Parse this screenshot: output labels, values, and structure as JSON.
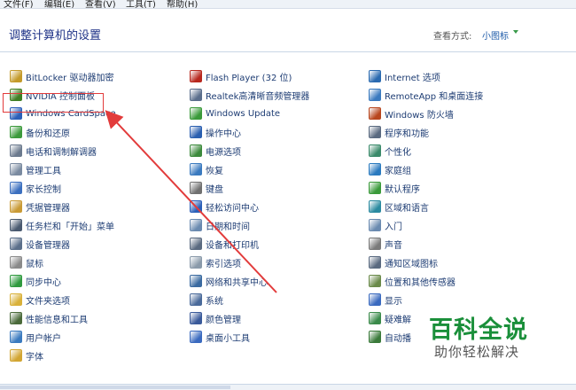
{
  "menubar": {
    "items": [
      "文件(F)",
      "编辑(E)",
      "查看(V)",
      "工具(T)",
      "帮助(H)"
    ]
  },
  "header": {
    "title": "调整计算机的设置",
    "view_by_label": "查看方式:",
    "view_mode": "小图标"
  },
  "columns": [
    [
      {
        "label": "BitLocker 驱动器加密",
        "icon": "bitlocker-icon",
        "color": "#c49a2a"
      },
      {
        "label": "NVIDIA 控制面板",
        "icon": "nvidia-icon",
        "color": "#3f7f24"
      },
      {
        "label": "Windows CardSpace",
        "icon": "cardspace-icon",
        "color": "#2b5fb8"
      },
      {
        "label": "备份和还原",
        "icon": "backup-icon",
        "color": "#3c9a3c"
      },
      {
        "label": "电话和调制解调器",
        "icon": "phone-modem-icon",
        "color": "#6b7a8e"
      },
      {
        "label": "管理工具",
        "icon": "admin-tools-icon",
        "color": "#7a8aa0"
      },
      {
        "label": "家长控制",
        "icon": "parental-control-icon",
        "color": "#3b6fbf"
      },
      {
        "label": "凭据管理器",
        "icon": "credential-icon",
        "color": "#c99a35"
      },
      {
        "label": "任务栏和「开始」菜单",
        "icon": "taskbar-icon",
        "color": "#4a5a70"
      },
      {
        "label": "设备管理器",
        "icon": "device-manager-icon",
        "color": "#5b6f8a"
      },
      {
        "label": "鼠标",
        "icon": "mouse-icon",
        "color": "#8a8a8a"
      },
      {
        "label": "同步中心",
        "icon": "sync-icon",
        "color": "#2f9a3f"
      },
      {
        "label": "文件夹选项",
        "icon": "folder-options-icon",
        "color": "#d9b13a"
      },
      {
        "label": "性能信息和工具",
        "icon": "performance-icon",
        "color": "#4a6a3a"
      },
      {
        "label": "用户帐户",
        "icon": "user-accounts-icon",
        "color": "#3a7abf"
      },
      {
        "label": "字体",
        "icon": "fonts-icon",
        "color": "#d2a532"
      }
    ],
    [
      {
        "label": "Flash Player (32 位)",
        "icon": "flash-icon",
        "color": "#b8281e"
      },
      {
        "label": "Realtek高清晰音频管理器",
        "icon": "realtek-icon",
        "color": "#5a6e8c"
      },
      {
        "label": "Windows Update",
        "icon": "windows-update-icon",
        "color": "#3a9a3a"
      },
      {
        "label": "操作中心",
        "icon": "action-center-icon",
        "color": "#2a5fb0"
      },
      {
        "label": "电源选项",
        "icon": "power-icon",
        "color": "#3c8a3c"
      },
      {
        "label": "恢复",
        "icon": "recovery-icon",
        "color": "#3a7abf"
      },
      {
        "label": "键盘",
        "icon": "keyboard-icon",
        "color": "#707070"
      },
      {
        "label": "轻松访问中心",
        "icon": "ease-access-icon",
        "color": "#2a5fb8"
      },
      {
        "label": "日期和时间",
        "icon": "date-time-icon",
        "color": "#6a8ab0"
      },
      {
        "label": "设备和打印机",
        "icon": "printer-icon",
        "color": "#5a6a80"
      },
      {
        "label": "索引选项",
        "icon": "indexing-icon",
        "color": "#8a9aaa"
      },
      {
        "label": "网络和共享中心",
        "icon": "network-icon",
        "color": "#3a6aa0"
      },
      {
        "label": "系统",
        "icon": "system-icon",
        "color": "#4a6a9a"
      },
      {
        "label": "颜色管理",
        "icon": "color-mgmt-icon",
        "color": "#3a5a9a"
      },
      {
        "label": "桌面小工具",
        "icon": "gadgets-icon",
        "color": "#3a6abf"
      }
    ],
    [
      {
        "label": "Internet 选项",
        "icon": "internet-icon",
        "color": "#2a6ab0"
      },
      {
        "label": "RemoteApp 和桌面连接",
        "icon": "remoteapp-icon",
        "color": "#3a7abf"
      },
      {
        "label": "Windows 防火墙",
        "icon": "firewall-icon",
        "color": "#b8461e"
      },
      {
        "label": "程序和功能",
        "icon": "programs-icon",
        "color": "#5a6a80"
      },
      {
        "label": "个性化",
        "icon": "personalize-icon",
        "color": "#3a8a6a"
      },
      {
        "label": "家庭组",
        "icon": "homegroup-icon",
        "color": "#2a7abf"
      },
      {
        "label": "默认程序",
        "icon": "default-programs-icon",
        "color": "#3a9a3a"
      },
      {
        "label": "区域和语言",
        "icon": "region-icon",
        "color": "#2a8aa0"
      },
      {
        "label": "入门",
        "icon": "getting-started-icon",
        "color": "#6a8ab0"
      },
      {
        "label": "声音",
        "icon": "sound-icon",
        "color": "#7a7a7a"
      },
      {
        "label": "通知区域图标",
        "icon": "notify-icon",
        "color": "#5a6a80"
      },
      {
        "label": "位置和其他传感器",
        "icon": "sensor-icon",
        "color": "#6a8a4a"
      },
      {
        "label": "显示",
        "icon": "display-icon",
        "color": "#3a6abf"
      },
      {
        "label": "疑难解",
        "icon": "troubleshoot-icon",
        "color": "#3a8a4a"
      },
      {
        "label": "自动播",
        "icon": "autoplay-icon",
        "color": "#3a7a3a"
      }
    ]
  ],
  "watermark": {
    "title": "百科全说",
    "subtitle": "助你轻松解决"
  },
  "colors": {
    "highlight": "#e23b3b",
    "title": "#1e3287",
    "link": "#1d3c73"
  }
}
